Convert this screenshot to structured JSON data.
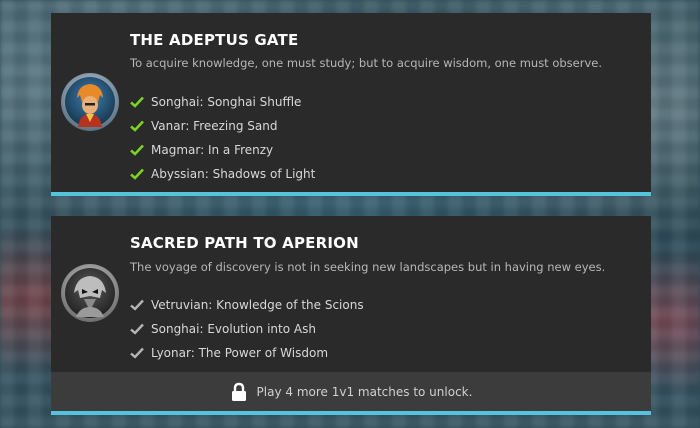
{
  "quests": [
    {
      "title": "THE ADEPTUS GATE",
      "description": "To acquire knowledge, one must study; but to acquire wisdom, one must observe.",
      "avatar_icon": "songhai-general-portrait",
      "check_color": "#7ed321",
      "steps": [
        "Songhai: Songhai Shuffle",
        "Vanar: Freezing Sand",
        "Magmar: In a Frenzy",
        "Abyssian: Shadows of Light"
      ]
    },
    {
      "title": "SACRED PATH TO APERION",
      "description": "The voyage of discovery is not in seeking new landscapes but in having new eyes.",
      "avatar_icon": "locked-general-portrait",
      "check_color": "#b5b5b5",
      "steps": [
        "Vetruvian: Knowledge of the Scions",
        "Songhai: Evolution into Ash",
        "Lyonar: The Power of Wisdom"
      ],
      "unlock_text": "Play 4 more 1v1 matches to unlock."
    }
  ],
  "colors": {
    "accent_bar": "#55c3dc",
    "card_bg": "#2a2a2b",
    "unlock_bg": "#3c3c3d"
  }
}
